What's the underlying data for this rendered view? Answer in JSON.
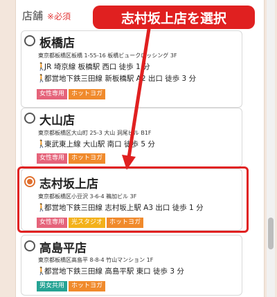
{
  "form": {
    "label": "店舗",
    "required": "※必須"
  },
  "callout": {
    "text": "志村坂上店を選択"
  },
  "stores": [
    {
      "name": "板橋店",
      "address": "東京都板橋区板橋 1-55-16 板橋ビュークロッシング 3F",
      "access": [
        "JR 埼京線 板橋駅 西口 徒歩 1 分",
        "都営地下鉄三田線 新板橋駅 A2 出口 徒歩 3 分"
      ],
      "tags": [
        "女性専用",
        "ホットヨガ"
      ],
      "selected": false
    },
    {
      "name": "大山店",
      "address": "東京都板橋区大山町 25-3 大山 洞尾ビル B1F",
      "access": [
        "東武東上線 大山駅 南口 徒歩 5 分"
      ],
      "tags": [
        "女性専用",
        "ホットヨガ"
      ],
      "selected": false
    },
    {
      "name": "志村坂上店",
      "address": "東京都板橋区小豆沢 3-6-4 鵜加ビル 3F",
      "access": [
        "都営地下鉄三田線 志村坂上駅 A3 出口 徒歩 1 分"
      ],
      "tags": [
        "女性専用",
        "光スタジオ",
        "ホットヨガ"
      ],
      "selected": true
    },
    {
      "name": "高島平店",
      "address": "東京都板橋区高島平 8-8-4 竹山マンション 1F",
      "access": [
        "都営地下鉄三田線 高島平駅 東口 徒歩 3 分"
      ],
      "tags": [
        "男女共用",
        "ホットヨガ"
      ],
      "selected": false
    }
  ],
  "colors": {
    "highlight": "#e02020",
    "radio_checked": "#e0702f",
    "tag_women": "#e5637a",
    "tag_hot": "#f08a2c",
    "tag_light": "#f3b11a",
    "tag_unisex": "#26a394"
  },
  "icons": {
    "walker": "walking-person-icon"
  }
}
